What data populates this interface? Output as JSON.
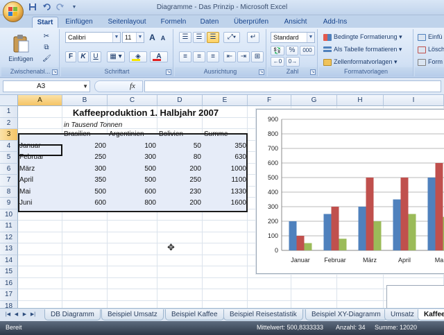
{
  "window": {
    "title": "Diagramme - Das Prinzip - Microsoft Excel"
  },
  "quick_access": [
    "save-icon",
    "undo-icon",
    "redo-icon"
  ],
  "ribbon": {
    "tabs": [
      "Start",
      "Einfügen",
      "Seitenlayout",
      "Formeln",
      "Daten",
      "Überprüfen",
      "Ansicht",
      "Add-Ins"
    ],
    "active_tab": "Start",
    "clipboard": {
      "paste": "Einfügen",
      "label": "Zwischenabl..."
    },
    "font": {
      "name": "Calibri",
      "size": "11",
      "label": "Schriftart",
      "bold": "F",
      "italic": "K",
      "underline": "U",
      "grow": "A",
      "shrink": "A",
      "color": "A"
    },
    "alignment": {
      "label": "Ausrichtung"
    },
    "number": {
      "format": "Standard",
      "percent": "%",
      "thousands": "000",
      "label": "Zahl"
    },
    "styles": {
      "conditional": "Bedingte Formatierung",
      "as_table": "Als Tabelle formatieren",
      "cell_styles": "Zellenformatvorlagen",
      "label": "Formatvorlagen"
    },
    "cells": {
      "insert": "Einfü",
      "delete": "Lösch",
      "format": "Form"
    }
  },
  "formula_bar": {
    "name_box": "A3",
    "fx": "fx",
    "formula": ""
  },
  "grid": {
    "columns": [
      "A",
      "B",
      "C",
      "D",
      "E",
      "F",
      "G",
      "H",
      "I"
    ],
    "rows": [
      "1",
      "2",
      "3",
      "4",
      "5",
      "6",
      "7",
      "8",
      "9",
      "10",
      "11",
      "12",
      "13",
      "14",
      "15",
      "16",
      "17",
      "18"
    ],
    "title": "Kaffeeproduktion 1. Halbjahr 2007",
    "subtitle": "in Tausend Tonnen",
    "headers": [
      "Brasilien",
      "Argentinien",
      "Bolivien",
      "Summe"
    ],
    "data": [
      {
        "month": "Januar",
        "values": [
          "200",
          "100",
          "50",
          "350"
        ]
      },
      {
        "month": "Februar",
        "values": [
          "250",
          "300",
          "80",
          "630"
        ]
      },
      {
        "month": "März",
        "values": [
          "300",
          "500",
          "200",
          "1000"
        ]
      },
      {
        "month": "April",
        "values": [
          "350",
          "500",
          "250",
          "1100"
        ]
      },
      {
        "month": "Mai",
        "values": [
          "500",
          "600",
          "230",
          "1330"
        ]
      },
      {
        "month": "Juni",
        "values": [
          "600",
          "800",
          "200",
          "1600"
        ]
      }
    ]
  },
  "chart_data": {
    "type": "bar",
    "categories": [
      "Januar",
      "Februar",
      "März",
      "April",
      "Ma"
    ],
    "series": [
      {
        "values": [
          200,
          250,
          300,
          350,
          500
        ],
        "color": "#4f81bd"
      },
      {
        "values": [
          100,
          300,
          500,
          500,
          600
        ],
        "color": "#c0504d"
      },
      {
        "values": [
          50,
          80,
          200,
          250,
          230
        ],
        "color": "#9bbb59"
      }
    ],
    "ylim": [
      0,
      900
    ],
    "yticks": [
      "0",
      "100",
      "200",
      "300",
      "400",
      "500",
      "600",
      "700",
      "800",
      "900"
    ],
    "grid": true
  },
  "sheet_tabs": {
    "tabs": [
      "DB Diagramm",
      "Beispiel Umsatz",
      "Beispiel Kaffee",
      "Beispiel Reisestatistik",
      "Beispiel XY-Diagramm",
      "Umsatz",
      "Kaffee"
    ],
    "active": "Kaffee"
  },
  "status_bar": {
    "mode": "Bereit",
    "average": "Mittelwert: 500,8333333",
    "count": "Anzahl: 34",
    "sum": "Summe: 12020"
  }
}
